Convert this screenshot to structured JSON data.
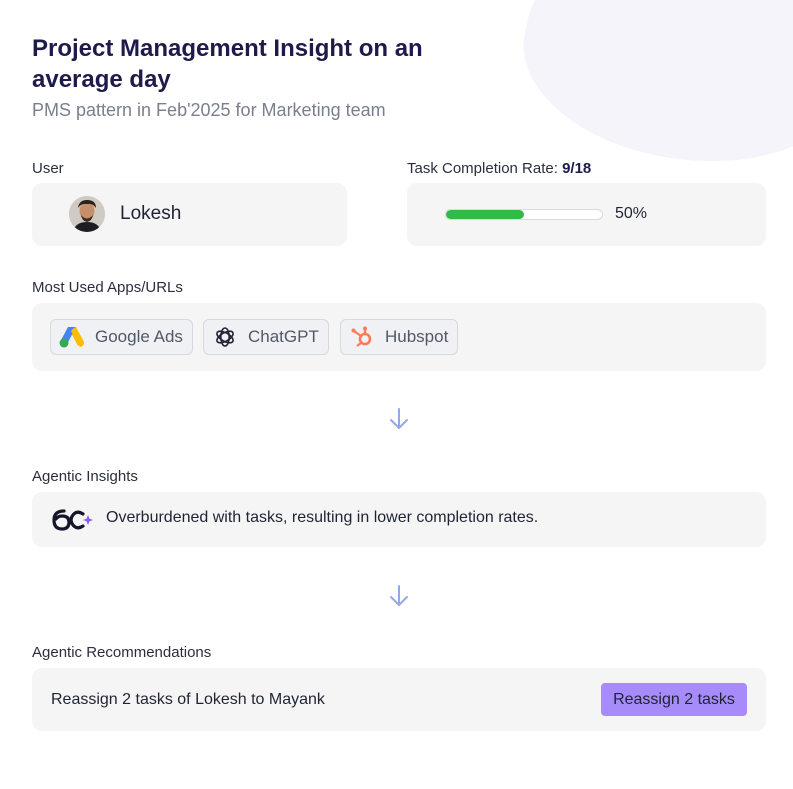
{
  "header": {
    "title": "Project Management Insight on an average day",
    "subtitle": "PMS pattern in Feb'2025 for Marketing team"
  },
  "user": {
    "label": "User",
    "name": "Lokesh",
    "avatar_icon": "user-avatar"
  },
  "task_completion": {
    "label": "Task Completion Rate:",
    "ratio": "9/18",
    "percent_text": "50%",
    "progress": 0.5,
    "bar_color": "#31b94a"
  },
  "apps": {
    "label": "Most Used Apps/URLs",
    "items": [
      {
        "name": "Google Ads",
        "icon": "google-ads-icon"
      },
      {
        "name": "ChatGPT",
        "icon": "chatgpt-icon"
      },
      {
        "name": "Hubspot",
        "icon": "hubspot-icon"
      }
    ]
  },
  "insights": {
    "label": "Agentic Insights",
    "text": "Overburdened with tasks, resulting in lower completion rates.",
    "icon": "agentic-logo-icon"
  },
  "recommendations": {
    "label": "Agentic Recommendations",
    "text": "Reassign 2 tasks of Lokesh to Mayank",
    "button_label": "Reassign 2 tasks",
    "button_color": "#a78bfa"
  }
}
